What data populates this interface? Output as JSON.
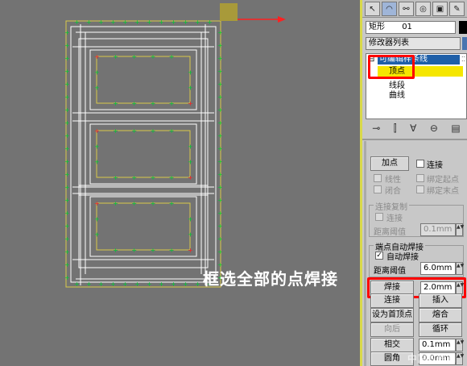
{
  "viewport": {
    "caption": "框选全部的点焊接",
    "grid_color": "#ffffff",
    "vertex_color": "#00cc33",
    "frame_color": "#d9c84a",
    "axis_color": "#ff2020"
  },
  "panel": {
    "tabs": [
      "arrow",
      "curve",
      "hierarchy",
      "motion",
      "display",
      "utility"
    ],
    "object_name": "矩形",
    "object_num": "01",
    "modifier_list_label": "修改器列表",
    "stack_title": "可编辑样条线",
    "stack_items": [
      "顶点",
      "线段",
      "曲线"
    ],
    "toolbar_icons": [
      "pin-icon",
      "pipe-icon",
      "funnel-icon",
      "lock-icon",
      "config-icon"
    ],
    "buttons": {
      "add_point": "加点",
      "weld": "焊接",
      "connect": "连接",
      "insert": "插入",
      "set_first": "设为首顶点",
      "fuse": "熔合",
      "reverse": "向后",
      "cycle": "循环",
      "intersect": "相交",
      "fillet": "圆角"
    },
    "checkboxes": {
      "connect": "连接",
      "linear": "线性",
      "bind_start": "绑定起点",
      "closed": "闭合",
      "bind_end": "绑定末点",
      "copy_connect": "连接",
      "auto_weld": "自动焊接"
    },
    "groups": {
      "connect_copy": "连接复制",
      "end_auto_weld": "端点自动焊接"
    },
    "labels": {
      "threshold_dist": "距离阈值",
      "threshold_dist2": "距离阈值"
    },
    "fields": {
      "copy_threshold": "0.1mm",
      "weld_threshold": "6.0mm",
      "weld_value": "2.0mm",
      "intersect_value": "0.1mm",
      "fillet_value": "0.0mm"
    },
    "watermark": "中国教程网"
  }
}
